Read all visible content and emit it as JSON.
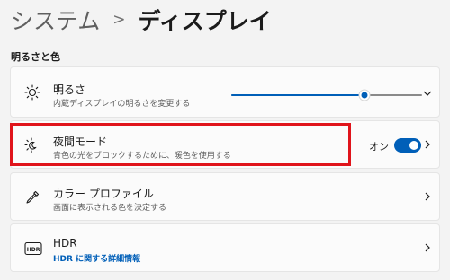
{
  "breadcrumb": {
    "parent": "システム",
    "separator": ">",
    "current": "ディスプレイ"
  },
  "section": {
    "title": "明るさと色"
  },
  "brightness": {
    "title": "明るさ",
    "description": "内蔵ディスプレイの明るさを変更する",
    "level_percent": 70,
    "icon": "sun-icon"
  },
  "night_light": {
    "title": "夜間モード",
    "description": "青色の光をブロックするために、暖色を使用する",
    "toggle_label": "オン",
    "toggle_on": true,
    "icon": "night-light-icon"
  },
  "color_profile": {
    "title": "カラー プロファイル",
    "description": "画面に表示される色を決定する",
    "icon": "eyedropper-icon"
  },
  "hdr": {
    "title": "HDR",
    "link": "HDR に関する詳細情報",
    "icon": "hdr-icon",
    "icon_text": "HDR"
  },
  "colors": {
    "accent": "#005fb8",
    "highlight": "#e0141b"
  }
}
